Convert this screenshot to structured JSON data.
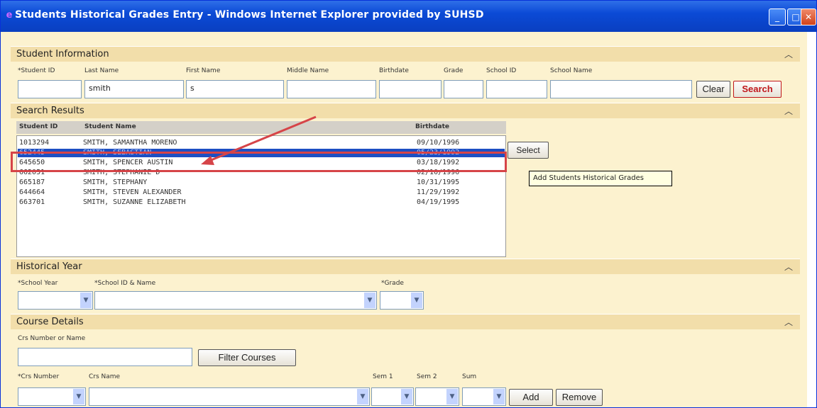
{
  "window": {
    "title": "Students Historical Grades Entry - Windows Internet Explorer provided by SUHSD"
  },
  "student_info": {
    "header": "Student Information",
    "labels": {
      "student_id": "*Student ID",
      "last_name": "Last Name",
      "first_name": "First Name",
      "middle_name": "Middle Name",
      "birthdate": "Birthdate",
      "grade": "Grade",
      "school_id": "School ID",
      "school_name": "School Name"
    },
    "values": {
      "student_id": "",
      "last_name": "smith",
      "first_name": "s",
      "middle_name": "",
      "birthdate": "",
      "grade": "",
      "school_id": "",
      "school_name": ""
    },
    "clear_label": "Clear",
    "search_label": "Search"
  },
  "search_results": {
    "header": "Search Results",
    "columns": {
      "id": "Student ID",
      "name": "Student Name",
      "birthdate": "Birthdate"
    },
    "rows": [
      {
        "id": "1013294",
        "name": "SMITH, SAMANTHA MORENO",
        "birthdate": "09/10/1996"
      },
      {
        "id": "652445",
        "name": "SMITH, SEBASTIAN",
        "birthdate": "05/23/1992"
      },
      {
        "id": "645650",
        "name": "SMITH, SPENCER AUSTIN",
        "birthdate": "03/18/1992"
      },
      {
        "id": "662051",
        "name": "SMITH, STEPHANIE D",
        "birthdate": "02/10/1996"
      },
      {
        "id": "665187",
        "name": "SMITH, STEPHANY",
        "birthdate": "10/31/1995"
      },
      {
        "id": "644664",
        "name": "SMITH, STEVEN ALEXANDER",
        "birthdate": "11/29/1992"
      },
      {
        "id": "663701",
        "name": "SMITH, SUZANNE ELIZABETH",
        "birthdate": "04/19/1995"
      }
    ],
    "select_label": "Select",
    "tooltip": "Add Students Historical Grades"
  },
  "historical_year": {
    "header": "Historical Year",
    "labels": {
      "school_year": "*School Year",
      "school": "*School ID & Name",
      "grade": "*Grade"
    }
  },
  "course_details": {
    "header": "Course Details",
    "filter_label": "Crs Number or Name",
    "filter_value": "",
    "filter_button": "Filter Courses",
    "labels": {
      "crs_number": "*Crs Number",
      "crs_name": "Crs Name",
      "sem1": "Sem 1",
      "sem2": "Sem 2",
      "sum": "Sum"
    },
    "add_label": "Add",
    "remove_label": "Remove"
  },
  "colors": {
    "panel": "#fcf2cf",
    "section_header": "#f2deaa",
    "selection": "#1d4fc3",
    "highlight_box": "#d64448",
    "titlebar": "#0b4ad6"
  }
}
